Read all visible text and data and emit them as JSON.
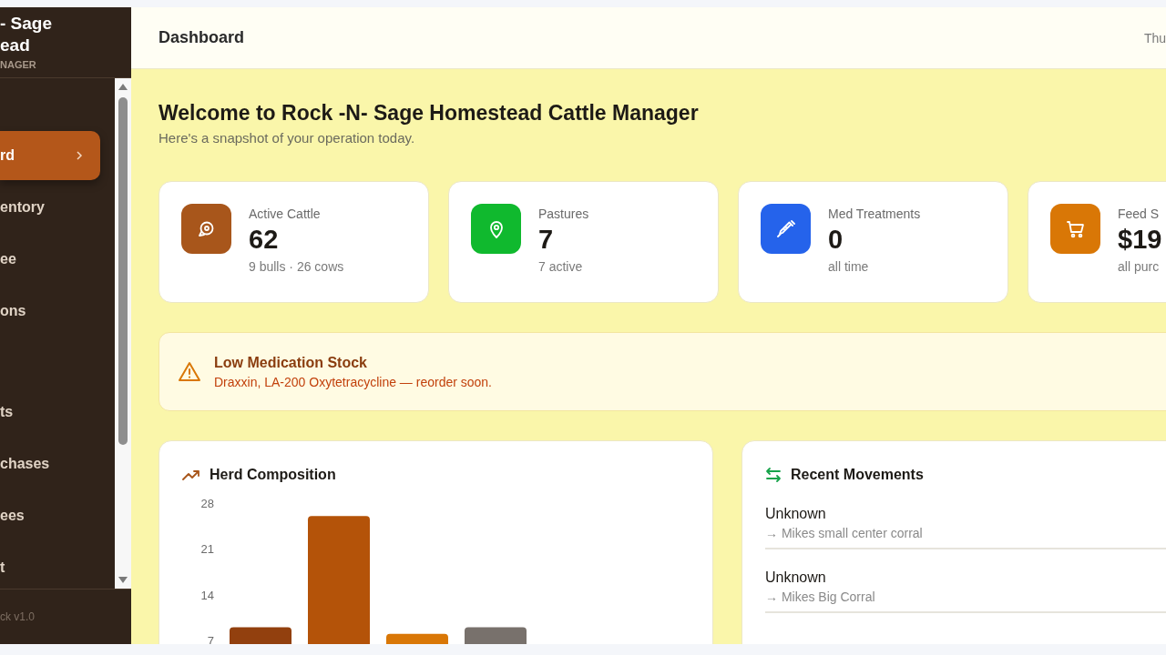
{
  "sidebar": {
    "brand_lines": [
      "- Sage",
      "ead"
    ],
    "brand_sub": "NAGER",
    "items": [
      {
        "label": "rd",
        "selected": true
      },
      {
        "label": "entory",
        "selected": false
      },
      {
        "label": "ee",
        "selected": false
      },
      {
        "label": "ons",
        "selected": false
      },
      {
        "label": "ts",
        "selected": false
      },
      {
        "label": "chases",
        "selected": false
      },
      {
        "label": "ees",
        "selected": false
      },
      {
        "label": "t",
        "selected": false
      }
    ],
    "footer": "ck v1.0"
  },
  "header": {
    "title": "Dashboard",
    "date": "Thu"
  },
  "welcome": {
    "title": "Welcome to Rock -N- Sage Homestead Cattle Manager",
    "subtitle": "Here's a snapshot of your operation today."
  },
  "stats": [
    {
      "kind": "cattle",
      "color": "#a8561b",
      "label": "Active Cattle",
      "value": "62",
      "note": "9 bulls · 26 cows"
    },
    {
      "kind": "pin",
      "color": "#10b92e",
      "label": "Pastures",
      "value": "7",
      "note": "7 active"
    },
    {
      "kind": "syringe",
      "color": "#2563eb",
      "label": "Med Treatments",
      "value": "0",
      "note": "all time"
    },
    {
      "kind": "cart",
      "color": "#d97706",
      "label": "Feed S",
      "value": "$19",
      "note": "all purc"
    }
  ],
  "alert": {
    "title": "Low Medication Stock",
    "text": "Draxxin, LA-200 Oxytetracycline — reorder soon."
  },
  "herd": {
    "title": "Herd Composition",
    "chart_data": {
      "type": "bar",
      "stacked": true,
      "categories": [
        null,
        null,
        null,
        null
      ],
      "ylim": [
        0,
        28
      ],
      "yticks": [
        7,
        14,
        21,
        28
      ],
      "series": [
        {
          "color": "#92400e",
          "values": [
            9,
            null,
            null,
            null
          ]
        },
        {
          "color": "#b45309",
          "values": [
            null,
            26,
            null,
            null
          ]
        },
        {
          "color": "#d97706",
          "values": [
            null,
            null,
            8,
            null
          ]
        },
        {
          "color": "#78716c",
          "values": [
            null,
            null,
            null,
            9
          ]
        }
      ]
    }
  },
  "movements": {
    "title": "Recent Movements",
    "items": [
      {
        "name": "Unknown",
        "destination": "→ Mikes small center corral"
      },
      {
        "name": "Unknown",
        "destination": "→ Mikes Big Corral"
      }
    ]
  }
}
